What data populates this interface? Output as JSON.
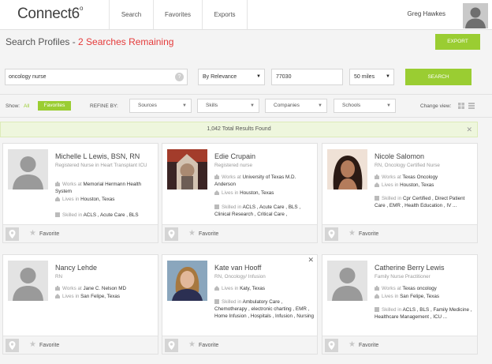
{
  "app": {
    "logo": "Connect6",
    "logo_mark": "o"
  },
  "nav": {
    "tabs": [
      "Search",
      "Favorites",
      "Exports"
    ]
  },
  "user": {
    "name": "Greg Hawkes"
  },
  "header": {
    "title": "Search Profiles",
    "separator": " - ",
    "remaining": "2 Searches Remaining",
    "export_label": "EXPORT"
  },
  "search": {
    "query": "oncology nurse",
    "sort": "By Relevance",
    "zip": "77030",
    "radius": "50 miles",
    "button_label": "SEARCH"
  },
  "filters": {
    "show_label": "Show:",
    "all_label": "All",
    "favorites_label": "Favorites",
    "refine_label": "REFINE BY:",
    "dropdowns": [
      "Sources",
      "Skills",
      "Companies",
      "Schools"
    ],
    "change_view_label": "Change view:"
  },
  "results": {
    "summary": "1,042 Total Results Found"
  },
  "card_common": {
    "favorite_label": "Favorite",
    "works_prefix": "Works at ",
    "lives_prefix": "Lives in ",
    "skilled_prefix": "Skilled in "
  },
  "profiles": [
    {
      "name": "Michelle L Lewis, BSN, RN",
      "title": "Registered Nurse in Heart Transplant ICU",
      "works_at": "Memorial Hermann Health System",
      "lives_in": "Houston, Texas",
      "skills": "ACLS , Acute Care , BLS"
    },
    {
      "name": "Edie Crupain",
      "title": "Registered nurse",
      "works_at": "University of Texas M.D. Anderson",
      "lives_in": "Houston, Texas",
      "skills": "ACLS , Acute Care , BLS , Clinical Research , Critical Care ,"
    },
    {
      "name": "Nicole Salomon",
      "title": "RN, Oncology Certified Nurse",
      "works_at": "Texas Oncology",
      "lives_in": "Houston, Texas",
      "skills": "Cpr Certified , Direct Patient Care , EMR , Health Education , IV ..."
    },
    {
      "name": "Nancy Lehde",
      "title": "RN",
      "works_at": "Jane C. Nelson MD",
      "lives_in": "San Felipe, Texas",
      "skills": ""
    },
    {
      "name": "Kate van Hooff",
      "title": "RN, Oncology/ Infusion",
      "works_at": "",
      "lives_in": "Katy, Texas",
      "skills": "Ambulatory Care , Chemotherapy , electronic charting , EMR , Home Infusion , Hospitals , Infusion , Nursing"
    },
    {
      "name": "Catherine Berry Lewis",
      "title": "Family Nurse Practitioner",
      "works_at": "Texas oncology",
      "lives_in": "San Felipe, Texas",
      "skills": "ACLS , BLS , Family Medicine , Healthcare Management , ICU ..."
    }
  ],
  "colors": {
    "accent": "#9acd32",
    "alert": "#e53a3a",
    "banner_bg": "#eef6dd"
  }
}
